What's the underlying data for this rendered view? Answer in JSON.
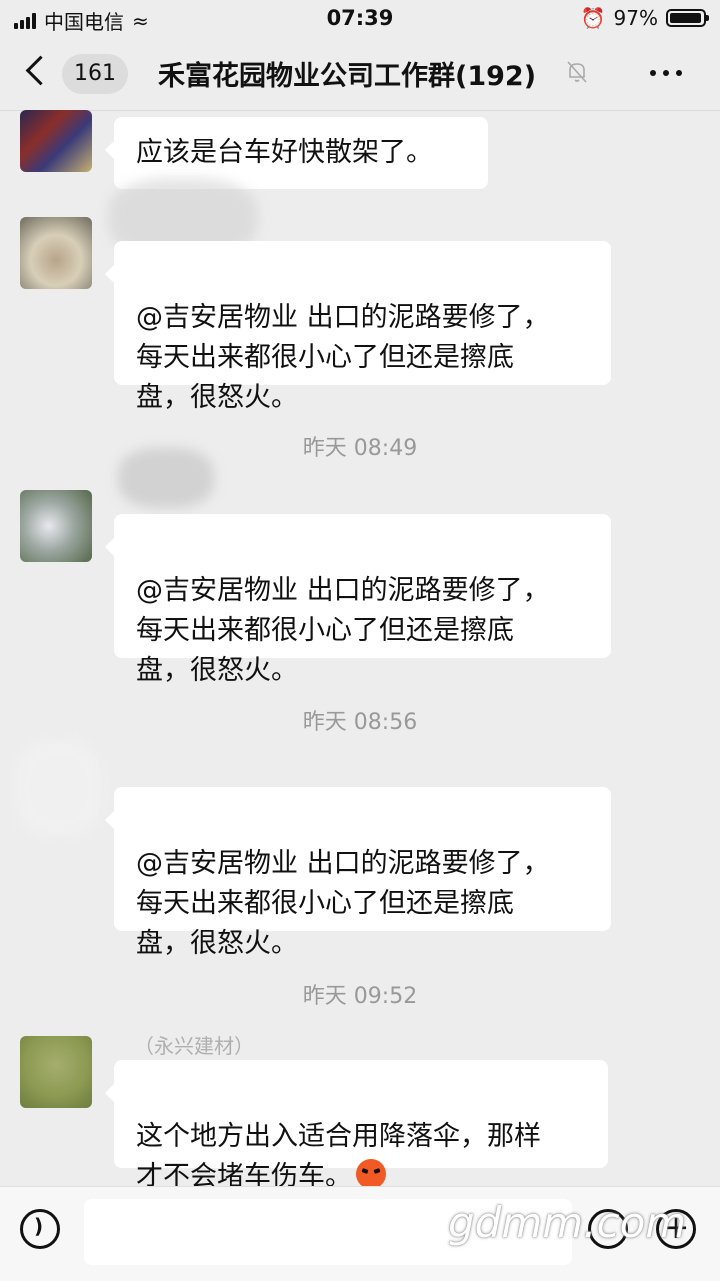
{
  "status_bar": {
    "carrier": "中国电信",
    "time": "07:39",
    "battery": "97%",
    "battery_level": 0.97
  },
  "nav": {
    "back_count": "161",
    "title": "禾富花园物业公司工作群(192)"
  },
  "messages": [
    {
      "text": "应该是台车好快散架了。"
    },
    {
      "text": "@吉安居物业 出口的泥路要修了，\n每天出来都很小心了但还是擦底\n盘，很怒火。"
    },
    {
      "timestamp": "昨天 08:49",
      "text": "@吉安居物业 出口的泥路要修了，\n每天出来都很小心了但还是擦底\n盘，很怒火。"
    },
    {
      "timestamp": "昨天 08:56",
      "text": "@吉安居物业 出口的泥路要修了，\n每天出来都很小心了但还是擦底\n盘，很怒火。"
    },
    {
      "timestamp": "昨天 09:52",
      "sender": "（永兴建材）",
      "text": "这个地方出入适合用降落伞，那样\n才不会堵车伤车。",
      "emoji": "angry-face-icon"
    }
  ],
  "watermark": "gdmm.com",
  "colors": {
    "background": "#ededed",
    "bubble": "#ffffff",
    "timestamp": "#999999"
  }
}
